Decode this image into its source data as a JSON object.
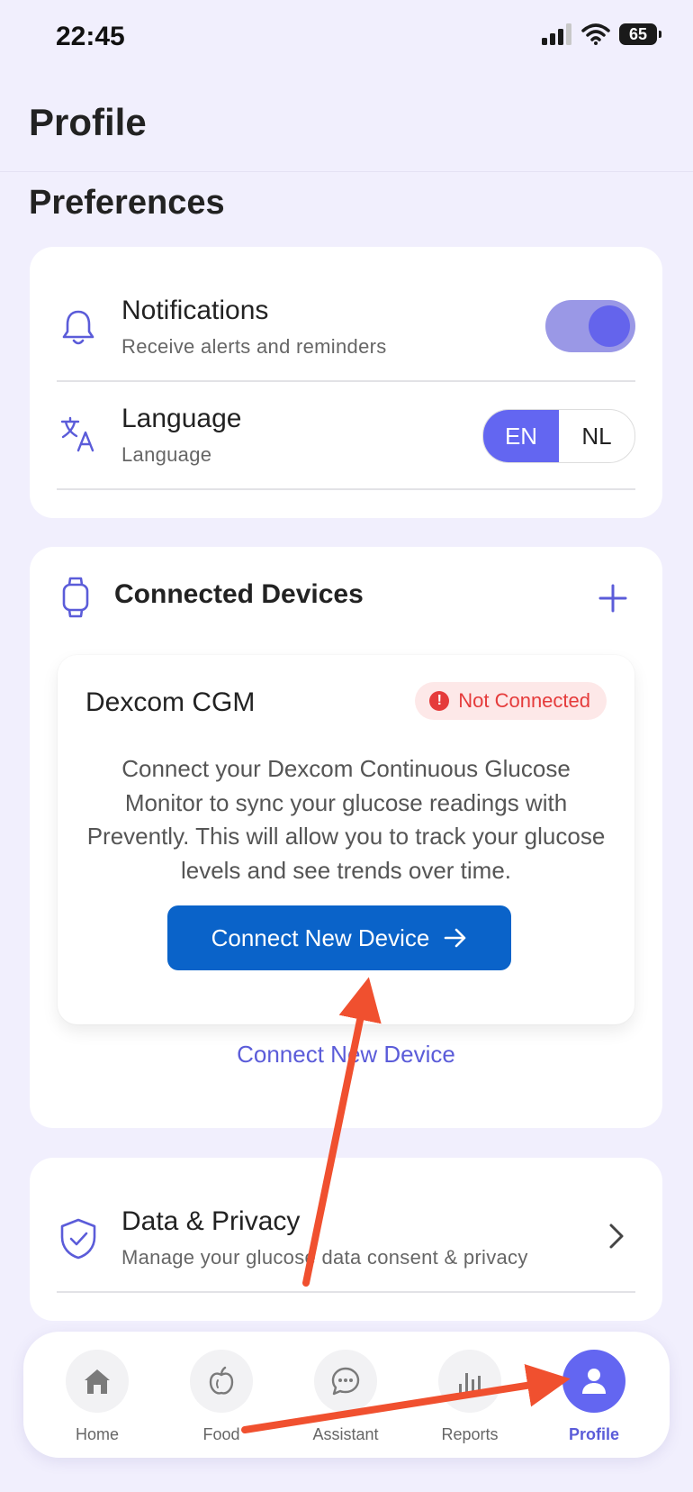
{
  "status_bar": {
    "time": "22:45",
    "battery": "65"
  },
  "header": {
    "title": "Profile"
  },
  "preferences": {
    "title": "Preferences",
    "notifications": {
      "title": "Notifications",
      "subtitle": "Receive alerts and reminders",
      "enabled": true
    },
    "language": {
      "title": "Language",
      "subtitle": "Language",
      "options": [
        "EN",
        "NL"
      ],
      "selected": "EN"
    }
  },
  "connected_devices": {
    "title": "Connected Devices",
    "device": {
      "name": "Dexcom CGM",
      "status": "Not Connected",
      "description": "Connect your Dexcom Continuous Glucose Monitor to sync your glucose readings with Prevently. This will allow you to track your glucose levels and see trends over time.",
      "button_label": "Connect New Device"
    },
    "link_label": "Connect New Device"
  },
  "data_privacy": {
    "title": "Data & Privacy",
    "subtitle": "Manage your glucose data consent & privacy"
  },
  "bottom_nav": {
    "items": [
      {
        "label": "Home",
        "icon": "home-icon"
      },
      {
        "label": "Food",
        "icon": "apple-icon"
      },
      {
        "label": "Assistant",
        "icon": "chat-icon"
      },
      {
        "label": "Reports",
        "icon": "bar-chart-icon"
      },
      {
        "label": "Profile",
        "icon": "user-icon"
      }
    ],
    "active": "Profile"
  },
  "colors": {
    "accent": "#6366f1",
    "primary_button": "#0a63c9",
    "danger": "#e53b3b",
    "background": "#f1effd",
    "annotation_arrow": "#f0502f"
  }
}
